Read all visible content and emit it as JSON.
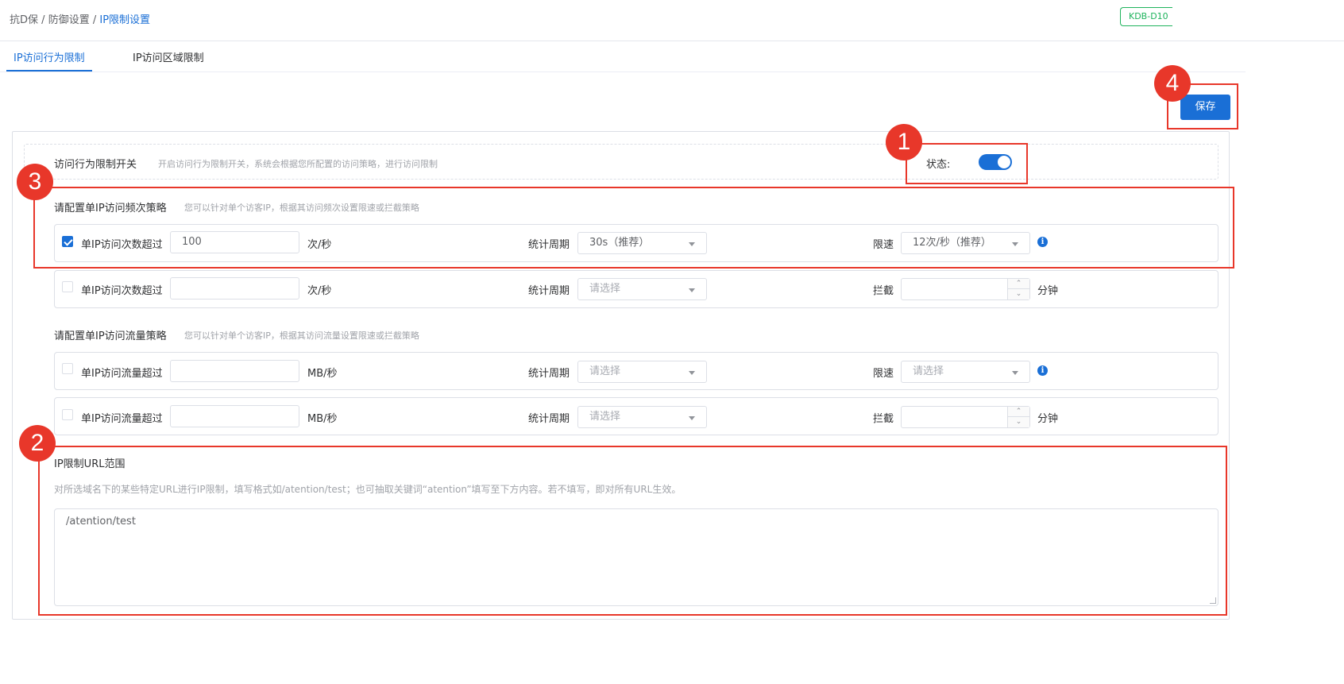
{
  "breadcrumb": {
    "item1": "抗D保",
    "sep1": "/",
    "item2": "防御设置",
    "sep2": "/",
    "current": "IP限制设置"
  },
  "env_badge": "KDB-D10",
  "tabs": [
    {
      "label": "IP访问行为限制",
      "active": true
    },
    {
      "label": "IP访问区域限制",
      "active": false
    }
  ],
  "save_label": "保存",
  "switch_section": {
    "title": "访问行为限制开关",
    "desc": "开启访问行为限制开关，系统会根据您所配置的访问策略，进行访问限制",
    "status_label": "状态:",
    "enabled": true
  },
  "freq_section": {
    "title": "请配置单IP访问频次策略",
    "desc": "您可以针对单个访客IP，根据其访问频次设置限速或拦截策略",
    "rows": [
      {
        "checked": true,
        "label": "单IP访问次数超过",
        "value": "100",
        "unit": "次/秒",
        "period_label": "统计周期",
        "period_value": "30s（推荐）",
        "action_label": "限速",
        "action_value": "12次/秒（推荐）"
      },
      {
        "checked": false,
        "label": "单IP访问次数超过",
        "value": "",
        "unit": "次/秒",
        "period_label": "统计周期",
        "period_placeholder": "请选择",
        "action_label": "拦截",
        "action_unit": "分钟"
      }
    ]
  },
  "traffic_section": {
    "title": "请配置单IP访问流量策略",
    "desc": "您可以针对单个访客IP，根据其访问流量设置限速或拦截策略",
    "rows": [
      {
        "checked": false,
        "label": "单IP访问流量超过",
        "value": "",
        "unit": "MB/秒",
        "period_label": "统计周期",
        "period_placeholder": "请选择",
        "action_label": "限速",
        "action_placeholder": "请选择"
      },
      {
        "checked": false,
        "label": "单IP访问流量超过",
        "value": "",
        "unit": "MB/秒",
        "period_label": "统计周期",
        "period_placeholder": "请选择",
        "action_label": "拦截",
        "action_unit": "分钟"
      }
    ]
  },
  "url_section": {
    "title": "IP限制URL范围",
    "desc": "对所选域名下的某些特定URL进行IP限制，填写格式如/atention/test；也可抽取关键词“atention”填写至下方内容。若不填写，即对所有URL生效。",
    "value": "/atention/test"
  },
  "annotations": [
    "1",
    "2",
    "3",
    "4"
  ],
  "colors": {
    "primary": "#1a6fd6",
    "annotation": "#e8372a",
    "badge": "#1eb35c"
  }
}
